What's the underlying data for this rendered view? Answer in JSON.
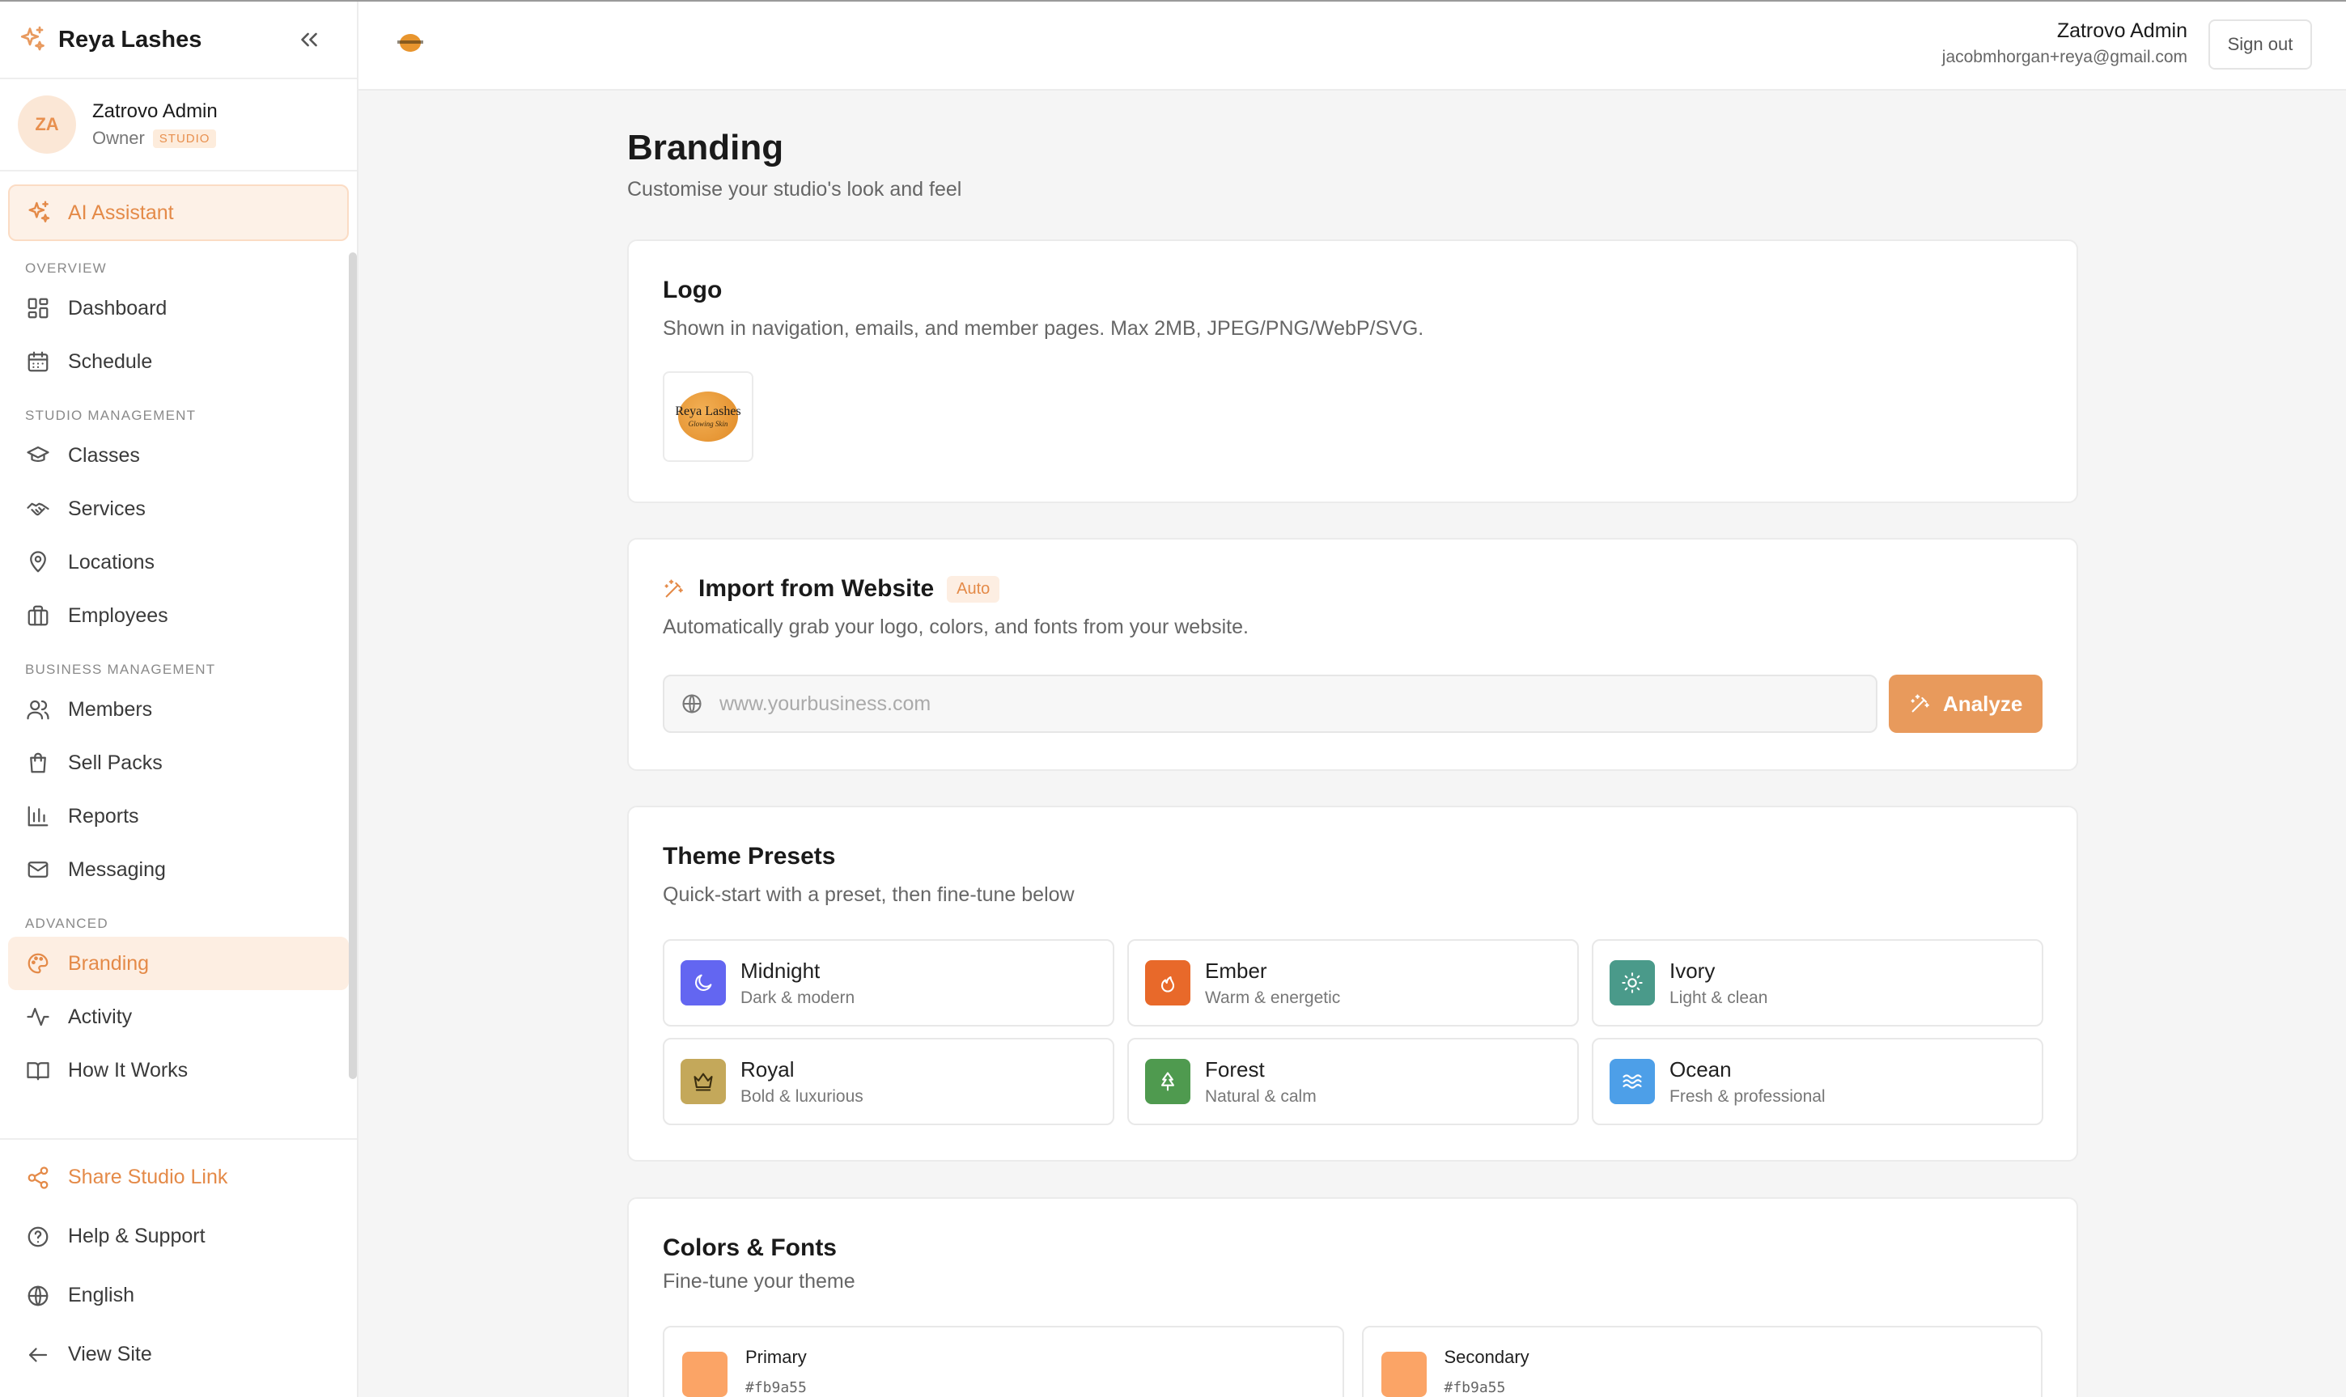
{
  "app": {
    "name": "Reya Lashes"
  },
  "user": {
    "initials": "ZA",
    "name": "Zatrovo Admin",
    "role": "Owner",
    "badge": "STUDIO",
    "email": "jacobmhorgan+reya@gmail.com"
  },
  "topbar": {
    "sign_out": "Sign out"
  },
  "sidebar": {
    "ai_assistant": "AI Assistant",
    "sections": {
      "overview": "OVERVIEW",
      "studio": "STUDIO MANAGEMENT",
      "business": "BUSINESS MANAGEMENT",
      "advanced": "ADVANCED"
    },
    "items": {
      "dashboard": "Dashboard",
      "schedule": "Schedule",
      "classes": "Classes",
      "services": "Services",
      "locations": "Locations",
      "employees": "Employees",
      "members": "Members",
      "sell_packs": "Sell Packs",
      "reports": "Reports",
      "messaging": "Messaging",
      "branding": "Branding",
      "activity": "Activity",
      "how_it_works": "How It Works"
    },
    "bottom": {
      "share": "Share Studio Link",
      "help": "Help & Support",
      "language": "English",
      "view_site": "View Site"
    }
  },
  "page": {
    "title": "Branding",
    "subtitle": "Customise your studio's look and feel"
  },
  "logo_card": {
    "title": "Logo",
    "description": "Shown in navigation, emails, and member pages. Max 2MB, JPEG/PNG/WebP/SVG.",
    "logo_text": "Reya Lashes",
    "logo_tagline": "Glowing Skin"
  },
  "import_card": {
    "title": "Import from Website",
    "badge": "Auto",
    "description": "Automatically grab your logo, colors, and fonts from your website.",
    "input_placeholder": "www.yourbusiness.com",
    "input_value": "",
    "button": "Analyze"
  },
  "presets_card": {
    "title": "Theme Presets",
    "description": "Quick-start with a preset, then fine-tune below",
    "presets": [
      {
        "name": "Midnight",
        "desc": "Dark & modern",
        "color": "#6366f1",
        "icon": "moon-icon"
      },
      {
        "name": "Ember",
        "desc": "Warm & energetic",
        "color": "#e8692a",
        "icon": "flame-icon"
      },
      {
        "name": "Ivory",
        "desc": "Light & clean",
        "color": "#4a9a8a",
        "icon": "sun-icon"
      },
      {
        "name": "Royal",
        "desc": "Bold & luxurious",
        "color": "#c4a85a",
        "icon": "crown-icon"
      },
      {
        "name": "Forest",
        "desc": "Natural & calm",
        "color": "#4f9a4f",
        "icon": "tree-icon"
      },
      {
        "name": "Ocean",
        "desc": "Fresh & professional",
        "color": "#4d9fe8",
        "icon": "waves-icon"
      }
    ]
  },
  "colors_card": {
    "title": "Colors & Fonts",
    "description": "Fine-tune your theme",
    "primary": {
      "label": "Primary",
      "hex": "#fb9a55"
    },
    "secondary": {
      "label": "Secondary",
      "hex": "#fb9a55"
    }
  }
}
